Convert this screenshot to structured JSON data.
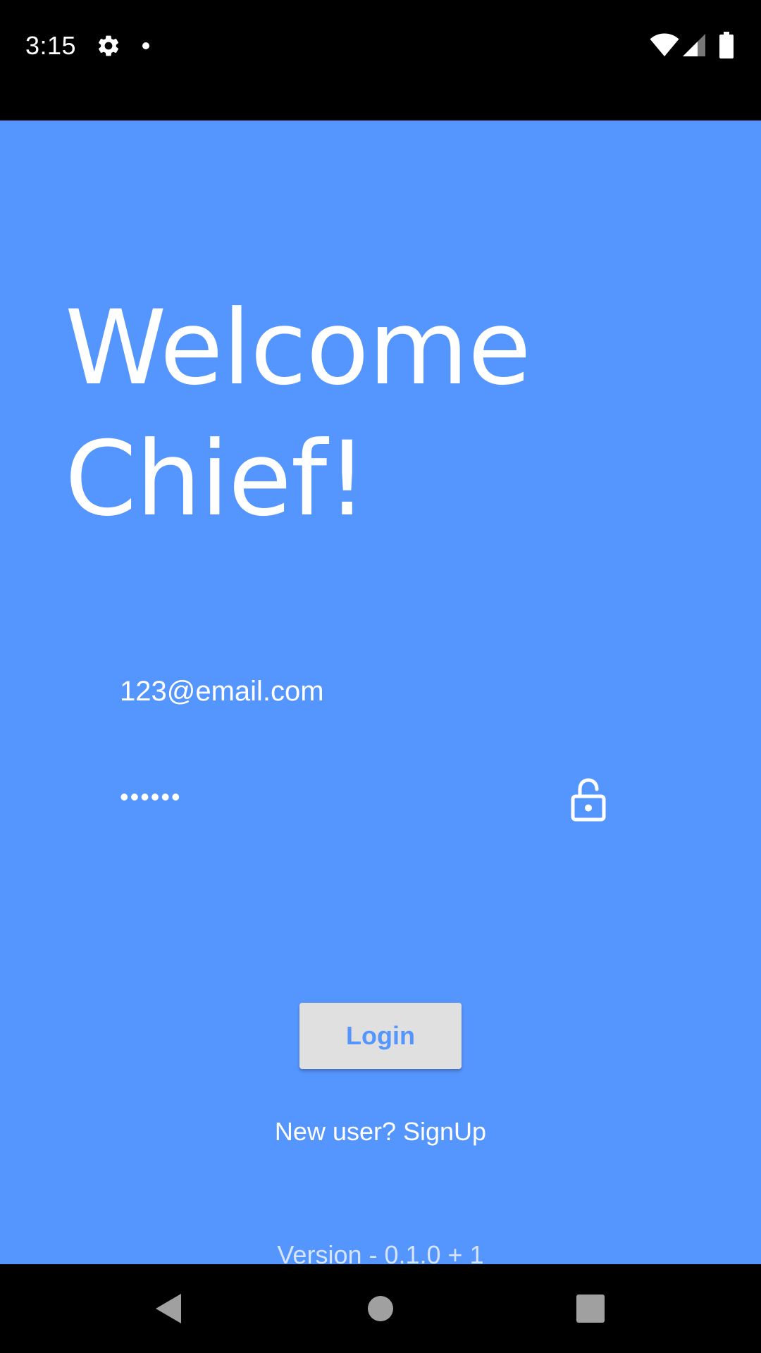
{
  "status_bar": {
    "time": "3:15",
    "icons": [
      "gear-icon",
      "notification-dot-icon",
      "wifi-icon",
      "cell-signal-icon",
      "battery-icon"
    ]
  },
  "login": {
    "title_line1": "Welcome",
    "title_line2": "Chief!",
    "email_value": "123@email.com",
    "password_value": "••••••",
    "lock_icon": "lock-open-icon",
    "login_label": "Login",
    "signup_label": "New user? SignUp",
    "version_label": "Version - 0.1.0 + 1"
  },
  "nav_bar": {
    "icons": [
      "back-icon",
      "home-icon",
      "recents-icon"
    ]
  },
  "colors": {
    "background": "#5596FE",
    "button": "#E0E0E0",
    "button_text": "#5596FE",
    "bars": "#000000",
    "version_text": "#D6E4FF"
  }
}
